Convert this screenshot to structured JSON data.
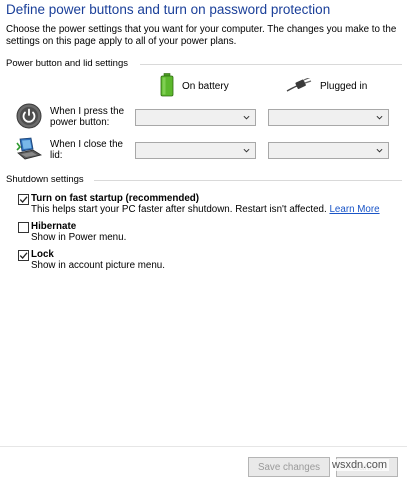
{
  "header": {
    "title": "Define power buttons and turn on password protection",
    "intro": "Choose the power settings that you want for your computer. The changes you make to the settings on this page apply to all of your power plans."
  },
  "power_section": {
    "label": "Power button and lid settings",
    "columns": [
      {
        "label": "On battery",
        "icon": "battery-icon"
      },
      {
        "label": "Plugged in",
        "icon": "power-plug-icon"
      }
    ],
    "rows": [
      {
        "label": "When I press the power button:",
        "icon": "power-button-icon",
        "battery_value": "",
        "plugged_value": ""
      },
      {
        "label": "When I close the lid:",
        "icon": "laptop-lid-icon",
        "battery_value": "",
        "plugged_value": ""
      }
    ]
  },
  "shutdown_section": {
    "label": "Shutdown settings",
    "options": [
      {
        "title": "Turn on fast startup (recommended)",
        "description": "This helps start your PC faster after shutdown. Restart isn't affected.",
        "link": "Learn More",
        "checked": true
      },
      {
        "title": "Hibernate",
        "description": "Show in Power menu.",
        "checked": false
      },
      {
        "title": "Lock",
        "description": "Show in account picture menu.",
        "checked": true
      }
    ]
  },
  "footer": {
    "save_label": "Save changes",
    "cancel_label": "Cancel",
    "watermark": "wsxdn.com"
  },
  "colors": {
    "title": "#1a3f99",
    "link": "#1a55c7",
    "battery_green": "#5cb82d"
  }
}
